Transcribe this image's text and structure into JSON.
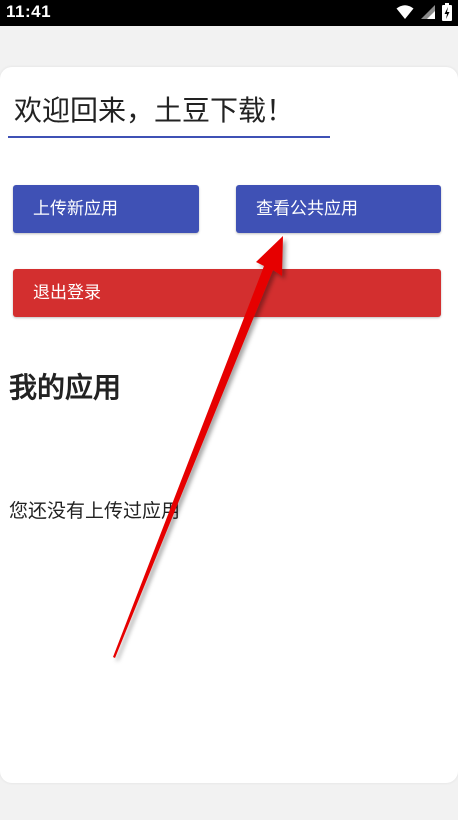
{
  "status_bar": {
    "time": "11:41",
    "icons": [
      "wifi-icon",
      "signal-icon",
      "battery-icon"
    ]
  },
  "welcome_field": {
    "value": "欢迎回来，土豆下载！"
  },
  "buttons": {
    "upload_label": "上传新应用",
    "public_label": "查看公共应用",
    "logout_label": "退出登录"
  },
  "my_apps": {
    "title": "我的应用",
    "empty_message": "您还没有上传过应用"
  },
  "colors": {
    "primary": "#3f51b5",
    "danger": "#d32f2f",
    "annotation_arrow": "#e60000"
  }
}
